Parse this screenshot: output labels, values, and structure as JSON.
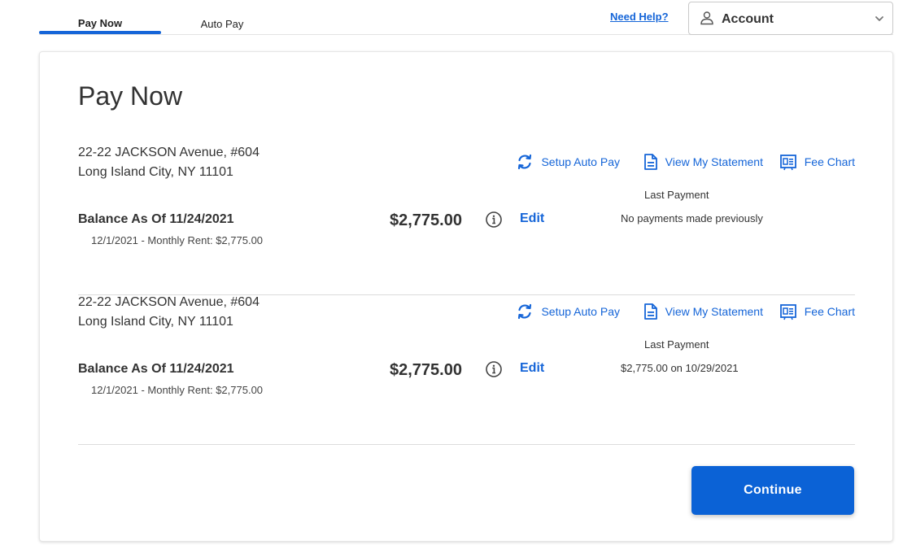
{
  "tabs": [
    {
      "label": "Pay Now",
      "active": true
    },
    {
      "label": "Auto Pay",
      "active": false
    }
  ],
  "header": {
    "need_help": "Need Help?",
    "account_label": "Account"
  },
  "page": {
    "title": "Pay Now"
  },
  "actions": {
    "setup_auto_pay": "Setup Auto Pay",
    "view_statement": "View My Statement",
    "fee_chart": "Fee Chart"
  },
  "properties": [
    {
      "address_line1": "22-22 JACKSON Avenue, #604",
      "address_line2": "Long Island City, NY 11101",
      "balance_label": "Balance As Of 11/24/2021",
      "balance_detail": "12/1/2021 - Monthly Rent: $2,775.00",
      "amount": "$2,775.00",
      "edit_label": "Edit",
      "last_payment_label": "Last Payment",
      "last_payment_value": "No payments made previously"
    },
    {
      "address_line1": "22-22 JACKSON Avenue, #604",
      "address_line2": "Long Island City, NY 11101",
      "balance_label": "Balance As Of 11/24/2021",
      "balance_detail": "12/1/2021 - Monthly Rent: $2,775.00",
      "amount": "$2,775.00",
      "edit_label": "Edit",
      "last_payment_label": "Last Payment",
      "last_payment_value": "$2,775.00 on 10/29/2021"
    }
  ],
  "continue_label": "Continue",
  "colors": {
    "accent": "#1565d8",
    "button": "#0b62d6"
  },
  "icons": {
    "account": "user-icon",
    "account_dropdown": "chevron-down-icon",
    "setup_auto_pay": "refresh-icon",
    "view_statement": "document-icon",
    "fee_chart": "fee-chart-icon",
    "balance_info": "info-icon"
  }
}
